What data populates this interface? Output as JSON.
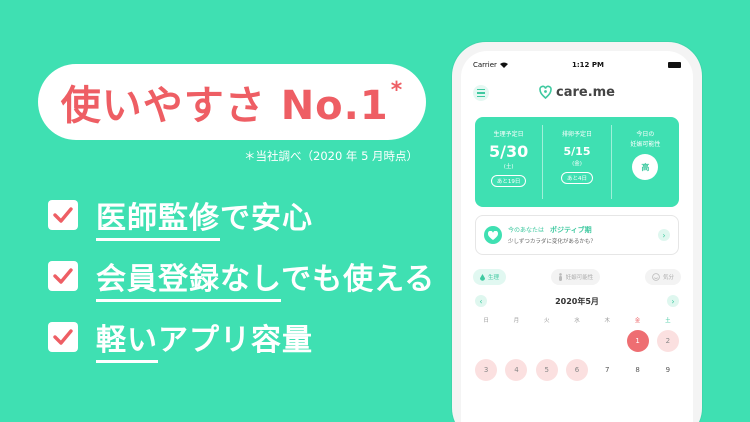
{
  "promo": {
    "headline": "使いやすさ No.1",
    "headline_mark": "*",
    "note": "＊当社調べ（2020 年 5 月時点）",
    "features": [
      {
        "highlight": "医師監修",
        "rest": "で安心"
      },
      {
        "highlight": "会員登録なし",
        "rest": "でも使える"
      },
      {
        "highlight": "軽い",
        "rest": "アプリ容量"
      }
    ]
  },
  "status_bar": {
    "carrier": "Carrier",
    "time": "1:12 PM"
  },
  "app": {
    "name": "care.me",
    "summary": {
      "period": {
        "label": "生理予定日",
        "date": "5/30",
        "dow": "(土)",
        "pill": "あと19日"
      },
      "ovulation": {
        "label": "排卵予定日",
        "date": "5/15",
        "dow": "(金)",
        "pill": "あと4日"
      },
      "fertility": {
        "label1": "今日の",
        "label2": "妊娠可能性",
        "level": "高"
      }
    },
    "phase_card": {
      "prefix": "今のあなたは",
      "phase": "ポジティブ期",
      "desc": "少しずつカラダに変化があるかも？"
    },
    "chips": [
      "生理",
      "妊娠可能性",
      "気分"
    ],
    "calendar": {
      "month": "2020年5月",
      "weekdays": [
        "日",
        "月",
        "火",
        "水",
        "木",
        "金",
        "土"
      ],
      "days": [
        "",
        "",
        "",
        "",
        "",
        "1",
        "2",
        "3",
        "4",
        "5",
        "6",
        "7",
        "8",
        "9"
      ]
    }
  },
  "colors": {
    "brand": "#3fe0b2",
    "accent": "#ee5e64"
  }
}
